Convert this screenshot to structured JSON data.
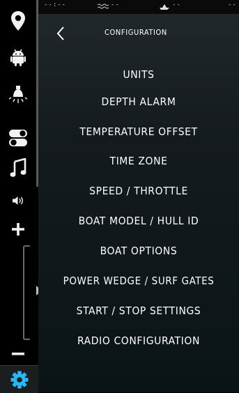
{
  "status_bar": {
    "left": "--:--",
    "middle": "--",
    "right": "--",
    "far_right": "--"
  },
  "header": {
    "back_icon": "chevron-left-icon",
    "title": "CONFIGURATION"
  },
  "sidebar": {
    "items": [
      {
        "icon": "location-pin-icon"
      },
      {
        "icon": "android-icon"
      },
      {
        "icon": "light-bulb-icon"
      },
      {
        "icon": "toggle-switches-icon"
      },
      {
        "icon": "music-note-icon"
      }
    ],
    "volume": {
      "speaker_icon": "speaker-icon",
      "plus_icon": "plus-icon",
      "minus_icon": "minus-icon"
    },
    "settings_icon": "gear-icon"
  },
  "menu": [
    "UNITS",
    "DEPTH ALARM",
    "TEMPERATURE OFFSET",
    "TIME ZONE",
    "SPEED / THROTTLE",
    "BOAT MODEL / HULL ID",
    "BOAT OPTIONS",
    "POWER WEDGE / SURF GATES",
    "START / STOP SETTINGS",
    "RADIO CONFIGURATION"
  ],
  "colors": {
    "accent": "#29b6f6",
    "rail_background": "#000000",
    "panel_top": "#22292c",
    "panel_bottom": "#0a1416",
    "text": "#ffffff"
  }
}
